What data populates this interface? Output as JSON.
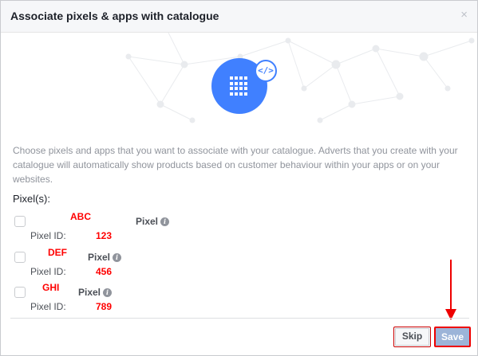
{
  "dialog": {
    "title": "Associate pixels & apps with catalogue",
    "close_glyph": "×"
  },
  "hero": {
    "main_icon": "grid-icon",
    "badge_icon": "code-icon",
    "badge_text": "</>"
  },
  "description": "Choose pixels and apps that you want to associate with your catalogue. Adverts that you create with your catalogue will automatically show products based on customer behaviour within your apps or on your websites.",
  "section_label": "Pixel(s):",
  "pixels": [
    {
      "name": "ABC",
      "type": "Pixel",
      "id_label": "Pixel ID:",
      "id": "123",
      "checked": false
    },
    {
      "name": "DEF",
      "type": "Pixel",
      "id_label": "Pixel ID:",
      "id": "456",
      "checked": false
    },
    {
      "name": "GHI",
      "type": "Pixel",
      "id_label": "Pixel ID:",
      "id": "789",
      "checked": false
    }
  ],
  "footer": {
    "skip_label": "Skip",
    "save_label": "Save"
  },
  "colors": {
    "accent": "#4080ff",
    "annotation": "#ff0000",
    "save_disabled": "#9cb4d8"
  }
}
